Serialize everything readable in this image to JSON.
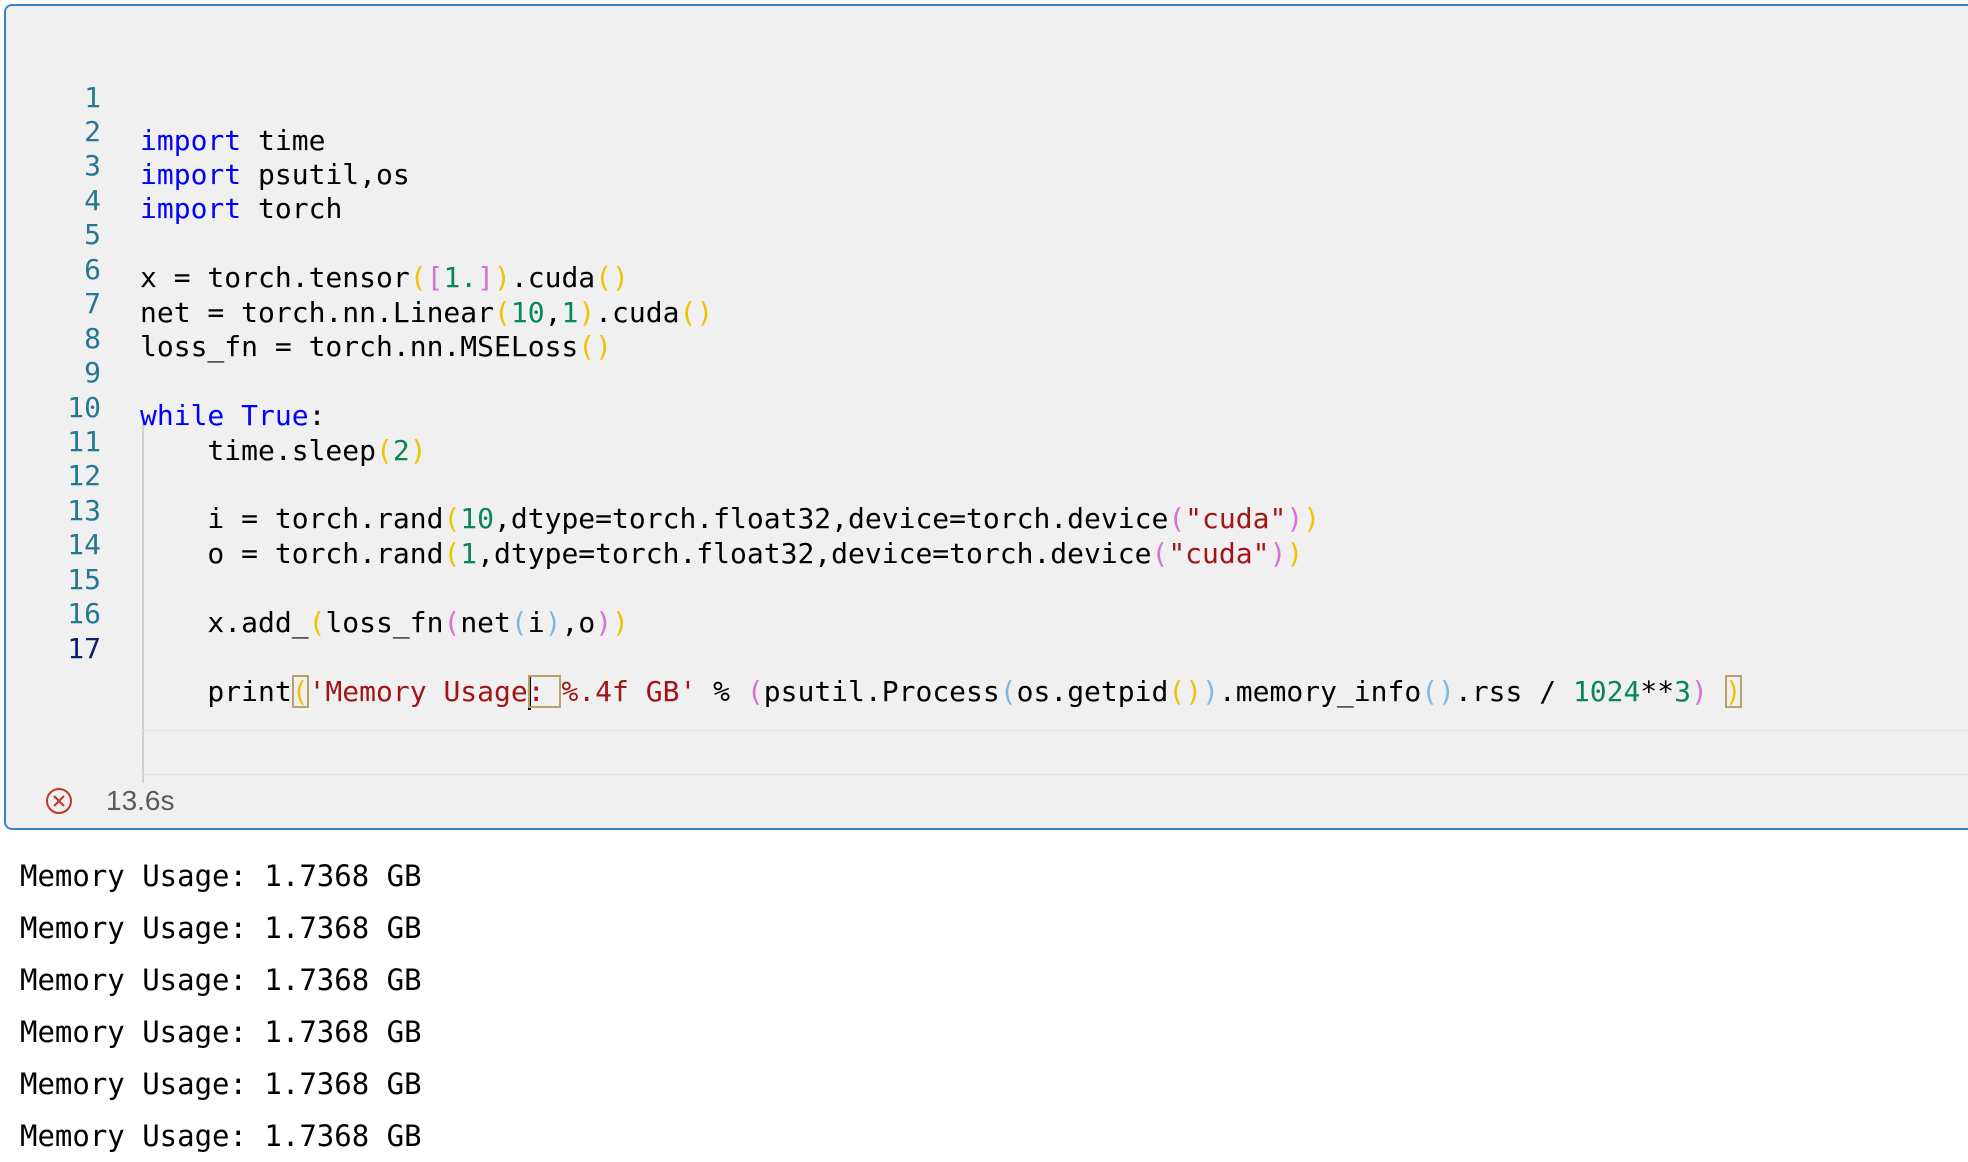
{
  "cell": {
    "line_numbers": [
      "1",
      "2",
      "3",
      "4",
      "5",
      "6",
      "7",
      "8",
      "9",
      "10",
      "11",
      "12",
      "13",
      "14",
      "15",
      "16",
      "17"
    ],
    "code": {
      "l1_kw": "import",
      "l1_rest": " time",
      "l2_kw": "import",
      "l2_rest": " psutil,os",
      "l3_kw": "import",
      "l3_rest": " torch",
      "l5_a": "x = torch.tensor",
      "l5_p1": "(",
      "l5_b1": "[",
      "l5_n": "1.",
      "l5_b2": "]",
      "l5_p2": ")",
      "l5_c": ".cuda",
      "l5_p3": "()",
      "l6_a": "net = torch.nn.Linear",
      "l6_p1": "(",
      "l6_n1": "10",
      "l6_c": ",",
      "l6_n2": "1",
      "l6_p2": ")",
      "l6_d": ".cuda",
      "l6_p3": "()",
      "l7_a": "loss_fn = torch.nn.MSELoss",
      "l7_p": "()",
      "l9_kw": "while",
      "l9_true": "True",
      "l9_colon": ":",
      "l10_a": "    time.sleep",
      "l10_p1": "(",
      "l10_n": "2",
      "l10_p2": ")",
      "l12_a": "    i = torch.rand",
      "l12_p1": "(",
      "l12_n": "10",
      "l12_b": ",dtype=torch.float32,device=torch.device",
      "l12_p2": "(",
      "l12_s": "\"cuda\"",
      "l12_p3": ")",
      "l12_p4": ")",
      "l13_a": "    o = torch.rand",
      "l13_p1": "(",
      "l13_n": "1",
      "l13_b": ",dtype=torch.float32,device=torch.device",
      "l13_p2": "(",
      "l13_s": "\"cuda\"",
      "l13_p3": ")",
      "l13_p4": ")",
      "l15_a": "    x.add_",
      "l15_p1": "(",
      "l15_b": "loss_fn",
      "l15_p2": "(",
      "l15_c": "net",
      "l15_p3": "(",
      "l15_d": "i",
      "l15_p4": ")",
      "l15_e": ",o",
      "l15_p5": ")",
      "l15_p6": ")",
      "l17_a": "    print",
      "l17_p1": "(",
      "l17_s1": "'Memory Usage",
      "l17_s2": ": ",
      "l17_s3": "%.4f GB'",
      "l17_b": " % ",
      "l17_p2": "(",
      "l17_c": "psutil.Process",
      "l17_p3": "(",
      "l17_d": "os.getpid",
      "l17_p4": "()",
      "l17_p5": ")",
      "l17_e": ".memory_info",
      "l17_p6": "()",
      "l17_f": ".rss / ",
      "l17_n1": "1024",
      "l17_g": "**",
      "l17_n2": "3",
      "l17_p7": ")",
      "l17_sp": " ",
      "l17_p8": ")"
    },
    "status": {
      "icon": "error-circle-icon",
      "duration": "13.6s"
    }
  },
  "output": {
    "lines": [
      "Memory Usage: 1.7368 GB",
      "Memory Usage: 1.7368 GB",
      "Memory Usage: 1.7368 GB",
      "Memory Usage: 1.7368 GB",
      "Memory Usage: 1.7368 GB",
      "Memory Usage: 1.7368 GB"
    ]
  },
  "colors": {
    "keyword": "#0000ff",
    "number": "#098658",
    "string": "#a31515",
    "line_number": "#237893",
    "cell_border": "#3b82c4"
  }
}
